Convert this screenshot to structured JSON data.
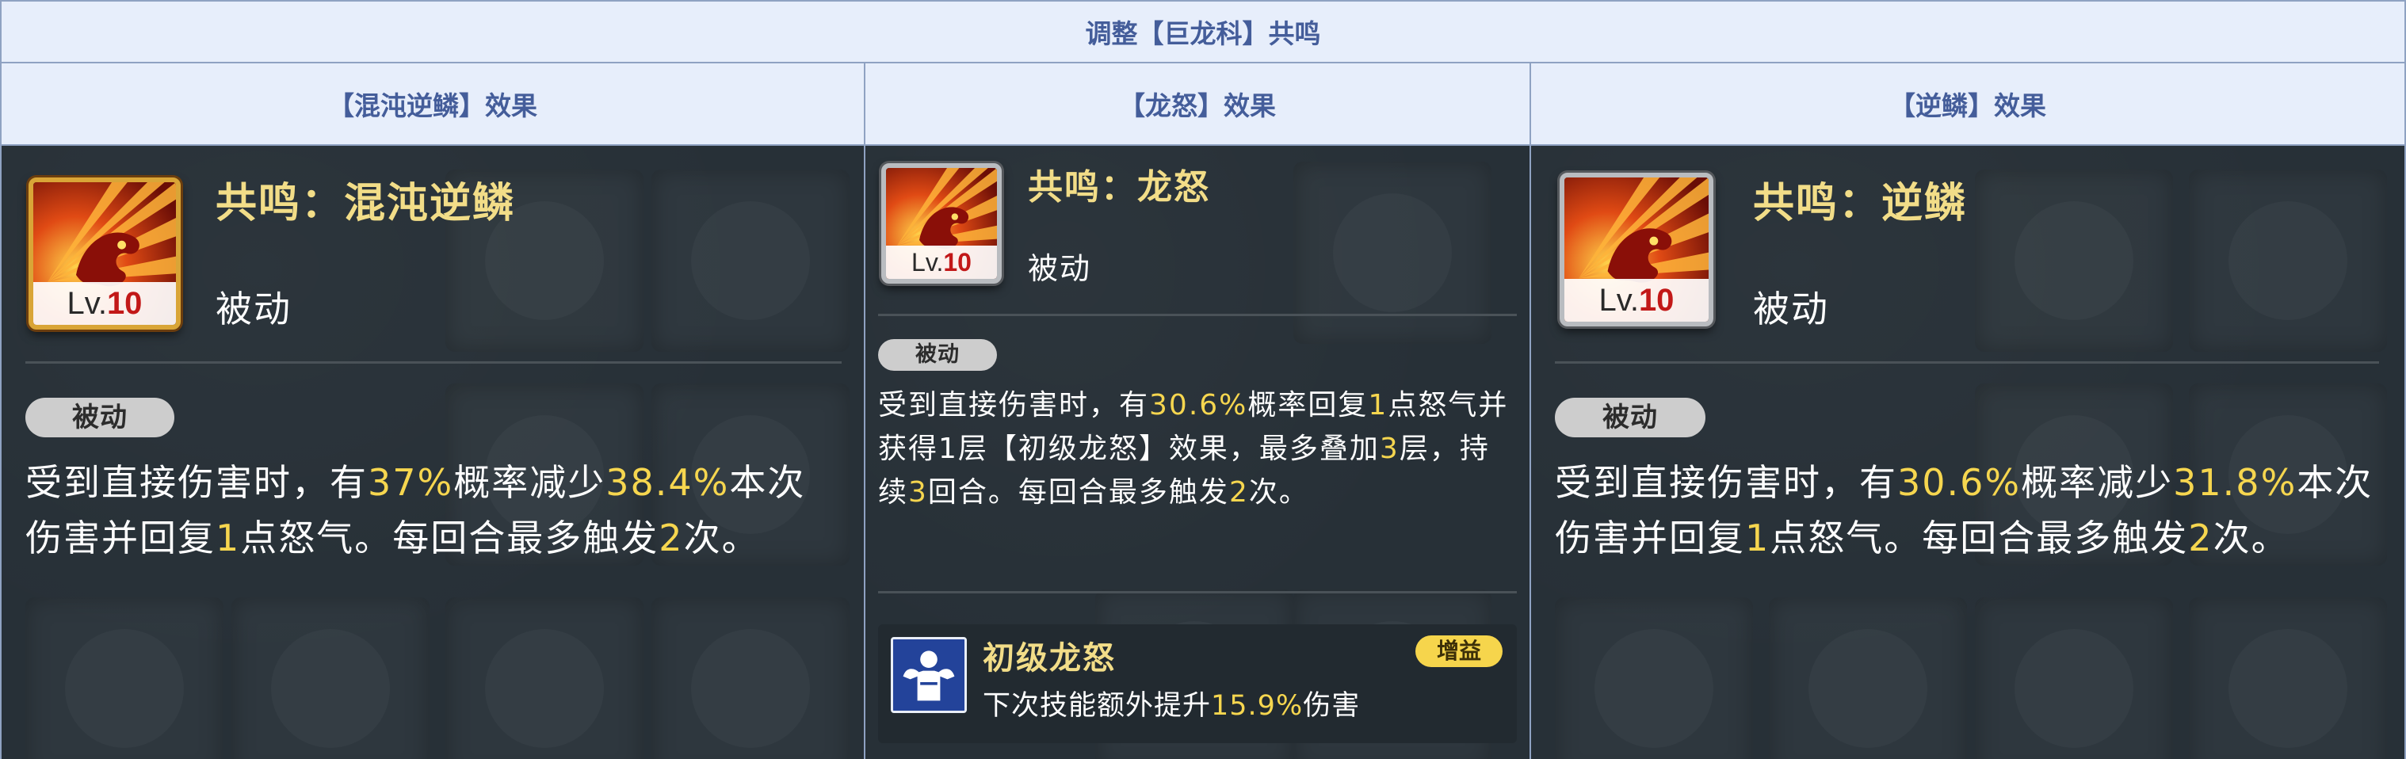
{
  "table": {
    "title": "调整【巨龙科】共鸣",
    "columns": [
      "【混沌逆鳞】效果",
      "【龙怒】效果",
      "【逆鳞】效果"
    ]
  },
  "cards": [
    {
      "skill_name": "共鸣：混沌逆鳞",
      "skill_type": "被动",
      "level_prefix": "Lv.",
      "level": "10",
      "frame": "gold",
      "tag": "被动",
      "desc_parts": [
        {
          "t": "受到直接伤害时，有",
          "h": false
        },
        {
          "t": "37%",
          "h": true
        },
        {
          "t": "概率减少",
          "h": false
        },
        {
          "t": "38.4%",
          "h": true
        },
        {
          "t": "本次伤害并回复",
          "h": false
        },
        {
          "t": "1",
          "h": true
        },
        {
          "t": "点怒气。每回合最多触发",
          "h": false
        },
        {
          "t": "2",
          "h": true
        },
        {
          "t": "次。",
          "h": false
        }
      ]
    },
    {
      "skill_name": "共鸣：龙怒",
      "skill_type": "被动",
      "level_prefix": "Lv.",
      "level": "10",
      "frame": "silver",
      "tag": "被动",
      "desc_parts": [
        {
          "t": "受到直接伤害时，有",
          "h": false
        },
        {
          "t": "30.6%",
          "h": true
        },
        {
          "t": "概率回复",
          "h": false
        },
        {
          "t": "1",
          "h": true
        },
        {
          "t": "点怒气并获得1层【初级龙怒】效果，最多叠加",
          "h": false
        },
        {
          "t": "3",
          "h": true
        },
        {
          "t": "层，持续",
          "h": false
        },
        {
          "t": "3",
          "h": true
        },
        {
          "t": "回合。每回合最多触发",
          "h": false
        },
        {
          "t": "2",
          "h": true
        },
        {
          "t": "次。",
          "h": false
        }
      ],
      "buff": {
        "name": "初级龙怒",
        "tag": "增益",
        "icon": "muscle-figure-icon",
        "desc_parts": [
          {
            "t": "下次技能额外提升",
            "h": false
          },
          {
            "t": "15.9%",
            "h": true
          },
          {
            "t": "伤害",
            "h": false
          }
        ]
      }
    },
    {
      "skill_name": "共鸣：逆鳞",
      "skill_type": "被动",
      "level_prefix": "Lv.",
      "level": "10",
      "frame": "silver",
      "tag": "被动",
      "desc_parts": [
        {
          "t": "受到直接伤害时，有",
          "h": false
        },
        {
          "t": "30.6%",
          "h": true
        },
        {
          "t": "概率减少",
          "h": false
        },
        {
          "t": "31.8%",
          "h": true
        },
        {
          "t": "本次伤害并回复",
          "h": false
        },
        {
          "t": "1",
          "h": true
        },
        {
          "t": "点怒气。每回合最多触发",
          "h": false
        },
        {
          "t": "2",
          "h": true
        },
        {
          "t": "次。",
          "h": false
        }
      ]
    }
  ],
  "colors": {
    "header_text": "#445d9a",
    "header_bg": "#e7eefb",
    "panel_bg": "#273037",
    "highlight": "#f6d64f",
    "skill_name": "#f2dd88"
  }
}
